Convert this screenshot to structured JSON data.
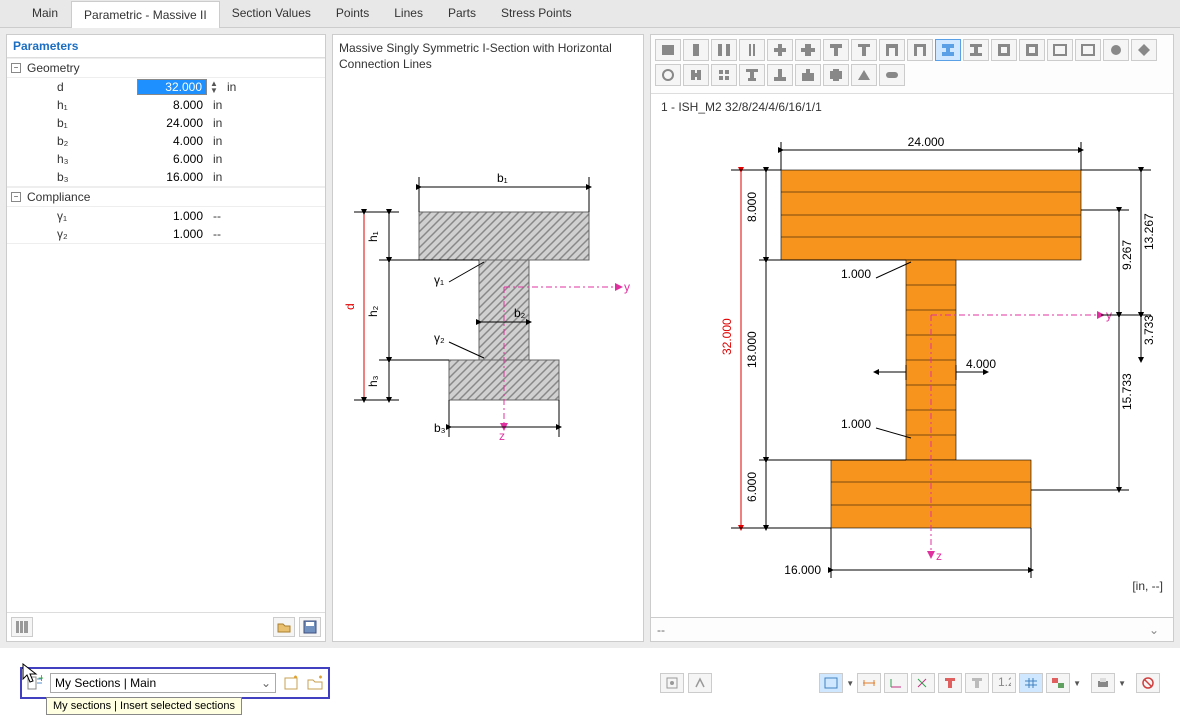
{
  "tabs": [
    {
      "label": "Main"
    },
    {
      "label": "Parametric - Massive II",
      "active": true
    },
    {
      "label": "Section Values"
    },
    {
      "label": "Points"
    },
    {
      "label": "Lines"
    },
    {
      "label": "Parts"
    },
    {
      "label": "Stress Points"
    }
  ],
  "sidebar": {
    "header": "Parameters",
    "groups": [
      {
        "name": "Geometry",
        "rows": [
          {
            "label": "d",
            "value": "32.000",
            "unit": "in",
            "selected": true
          },
          {
            "label": "h₁",
            "value": "8.000",
            "unit": "in"
          },
          {
            "label": "b₁",
            "value": "24.000",
            "unit": "in"
          },
          {
            "label": "b₂",
            "value": "4.000",
            "unit": "in"
          },
          {
            "label": "h₃",
            "value": "6.000",
            "unit": "in"
          },
          {
            "label": "b₃",
            "value": "16.000",
            "unit": "in"
          }
        ]
      },
      {
        "name": "Compliance",
        "rows": [
          {
            "label": "γ₁",
            "value": "1.000",
            "unit": "--"
          },
          {
            "label": "γ₂",
            "value": "1.000",
            "unit": "--"
          }
        ]
      }
    ]
  },
  "center": {
    "title": "Massive Singly Symmetric I-Section with Horizontal Connection Lines",
    "dims": {
      "d": "d",
      "h1": "h₁",
      "h2": "h₂",
      "h3": "h₃",
      "b1": "b₁",
      "b2": "b₂",
      "b3": "b₃",
      "g1": "γ₁",
      "g2": "γ₂",
      "y": "y",
      "z": "z"
    }
  },
  "right": {
    "title": "1 - ISH_M2 32/8/24/4/6/16/1/1",
    "dims": {
      "top_b": "24.000",
      "h1": "8.000",
      "d": "32.000",
      "h2": "18.000",
      "h3": "6.000",
      "b3": "16.000",
      "b2": "4.000",
      "g1": "1.000",
      "g2": "1.000",
      "r1": "13.267",
      "r2": "9.267",
      "r3": "3.733",
      "r4": "15.733",
      "y": "y",
      "z": "z"
    },
    "units": "[in, --]",
    "status_left": "--"
  },
  "my_sections": {
    "label": "My Sections | Main",
    "tooltip": "My sections | Insert selected sections"
  }
}
